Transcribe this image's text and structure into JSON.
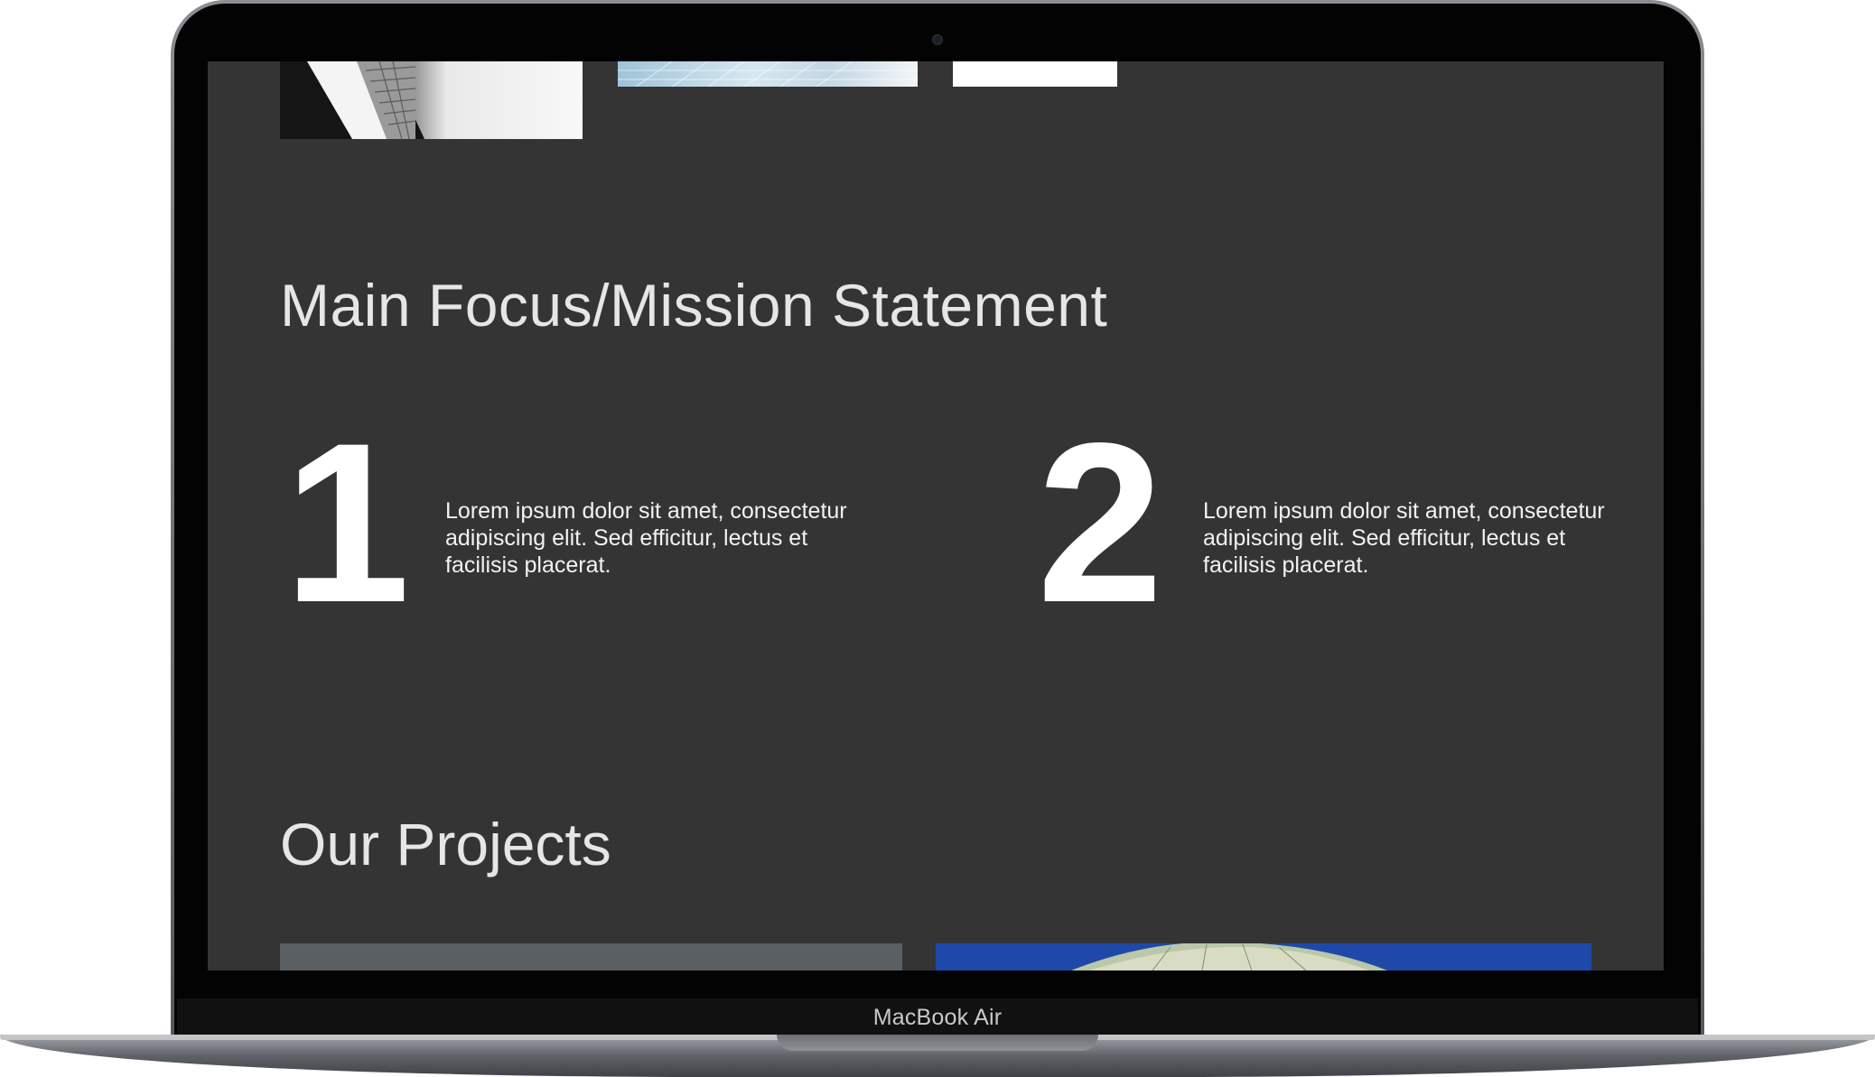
{
  "device": {
    "label": "MacBook Air"
  },
  "page": {
    "mission_title": "Main Focus/Mission Statement",
    "focus_items": [
      {
        "number": "1",
        "text": "Lorem ipsum dolor sit amet, consectetur adipiscing elit. Sed efficitur, lectus et facilisis placerat."
      },
      {
        "number": "2",
        "text": "Lorem ipsum dolor sit amet, consectetur adipiscing elit. Sed efficitur, lectus et facilisis placerat."
      }
    ],
    "projects_title": "Our Projects"
  },
  "colors": {
    "screen_background": "#343434",
    "heading_text": "#e6e6e6",
    "body_text": "#f2f2f2",
    "project_card_blue": "#1f49a8",
    "project_card_gray": "#5a5f63"
  }
}
